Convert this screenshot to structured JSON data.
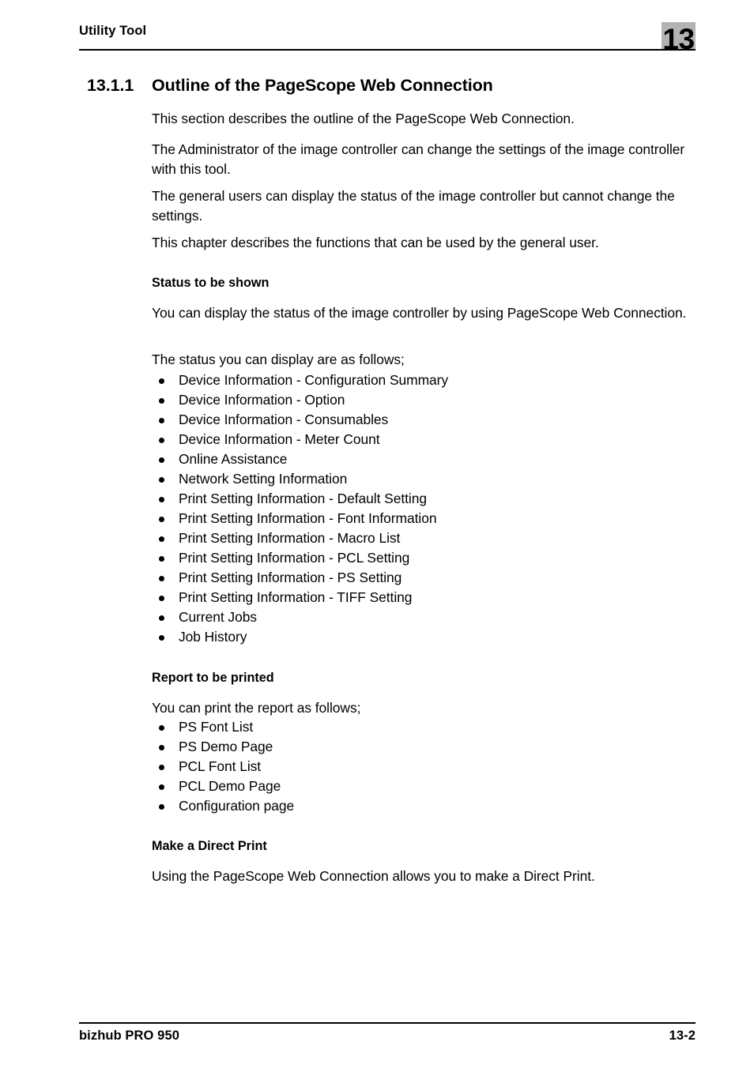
{
  "header": {
    "running_title": "Utility Tool",
    "chapter_number": "13",
    "badge_color": "#b3b3b3"
  },
  "section": {
    "number": "13.1.1",
    "title": "Outline of the PageScope Web Connection"
  },
  "intro_paragraphs": [
    "This section describes the outline of the PageScope Web Connection.",
    "The Administrator of the image controller can change the settings of the image controller with this tool.",
    "The general users can display the status of the image controller but cannot change the settings.",
    "This chapter describes the functions that can be used by the general user."
  ],
  "status_section": {
    "heading": "Status to be shown",
    "paragraph": "You can display the status of the image controller by using PageScope Web Connection.",
    "list_intro": "The status you can display are as follows;",
    "items": [
      "Device Information - Configuration Summary",
      "Device Information - Option",
      "Device Information - Consumables",
      "Device Information - Meter Count",
      "Online Assistance",
      "Network Setting Information",
      "Print Setting Information - Default Setting",
      "Print Setting Information - Font Information",
      "Print Setting Information - Macro List",
      "Print Setting Information - PCL Setting",
      "Print Setting Information - PS Setting",
      "Print Setting Information - TIFF Setting",
      "Current Jobs",
      "Job History"
    ]
  },
  "report_section": {
    "heading": "Report to be printed",
    "list_intro": "You can print the report as follows;",
    "items": [
      "PS Font List",
      "PS Demo Page",
      "PCL Font List",
      "PCL Demo Page",
      "Configuration page"
    ]
  },
  "direct_print_section": {
    "heading": "Make a Direct Print",
    "paragraph": "Using the PageScope Web Connection allows you to make a Direct Print."
  },
  "footer": {
    "product": "bizhub PRO 950",
    "page_number": "13-2"
  }
}
